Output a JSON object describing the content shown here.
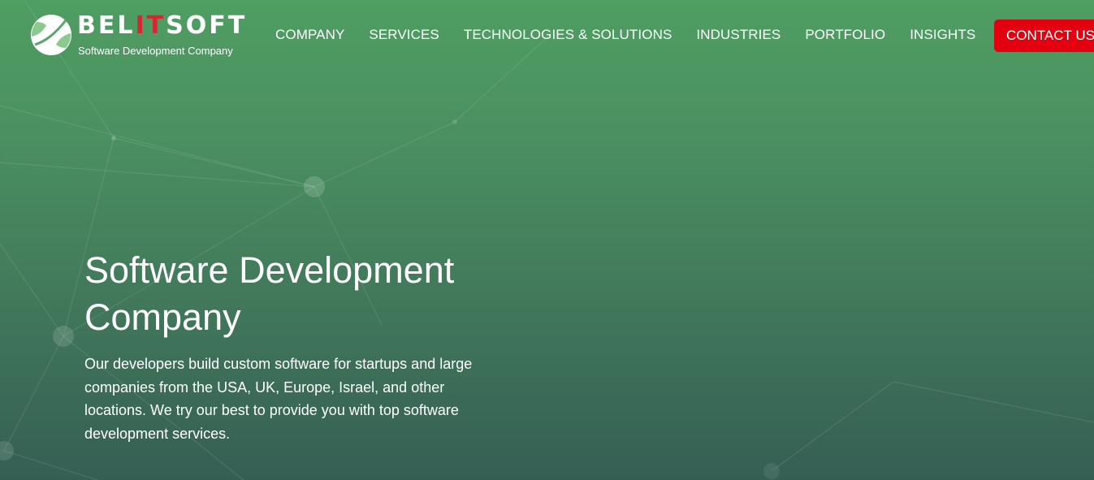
{
  "brand": {
    "name_prefix": "BEL",
    "name_highlight": "IT",
    "name_suffix": "SOFT",
    "tagline": "Software Development Company",
    "accent_color": "#d7262f",
    "logo_icon": "tennis-ball-logo-icon"
  },
  "nav": {
    "items": [
      {
        "label": "COMPANY"
      },
      {
        "label": "SERVICES"
      },
      {
        "label": "TECHNOLOGIES & SOLUTIONS"
      },
      {
        "label": "INDUSTRIES"
      },
      {
        "label": "PORTFOLIO"
      },
      {
        "label": "INSIGHTS"
      }
    ],
    "contact_label": "CONTACT US",
    "contact_color": "#e3000f"
  },
  "hero": {
    "title": "Software Development Company",
    "description": "Our developers build custom software for startups and large companies from the USA, UK, Europe, Israel, and other locations. We try our best to provide you with top software development services.",
    "background_color": "#4a8f60"
  }
}
